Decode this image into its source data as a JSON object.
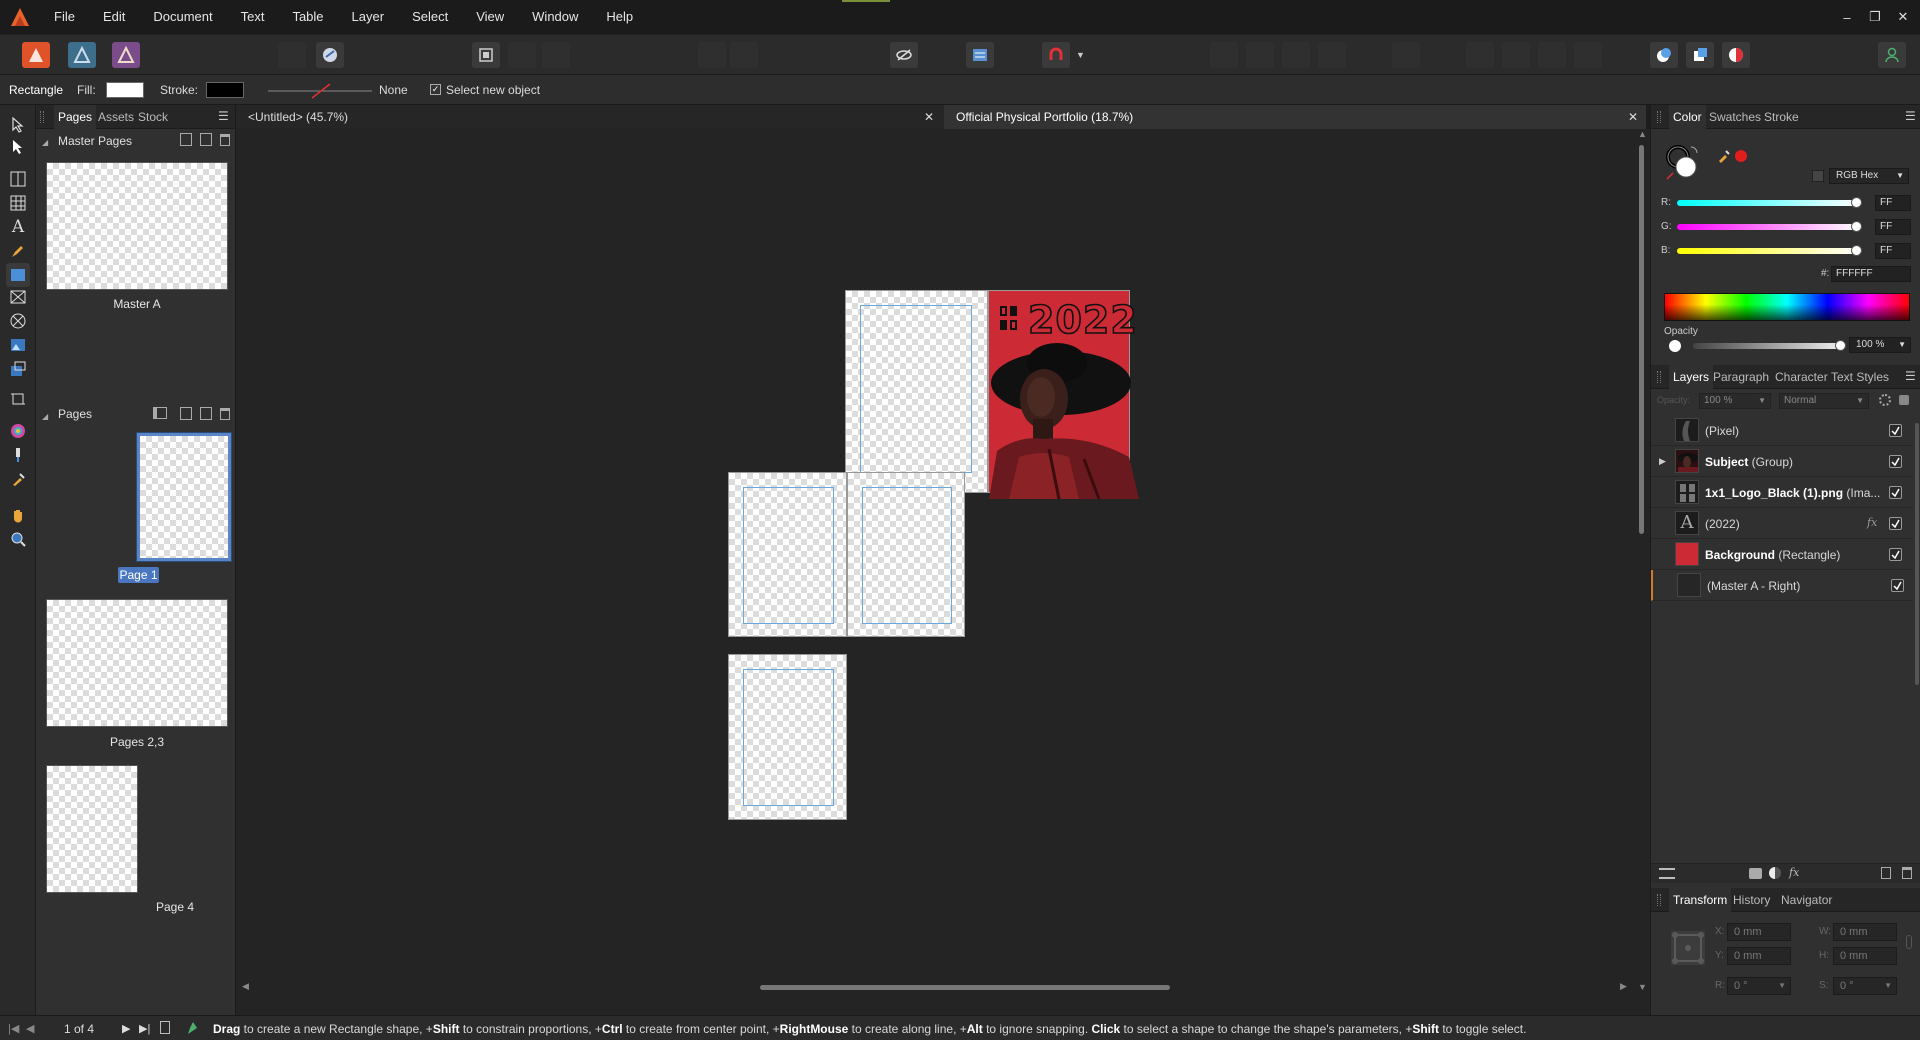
{
  "menu": [
    "File",
    "Edit",
    "Document",
    "Text",
    "Table",
    "Layer",
    "Select",
    "View",
    "Window",
    "Help"
  ],
  "context": {
    "tool_name": "Rectangle",
    "fill_label": "Fill:",
    "stroke_label": "Stroke:",
    "stroke_style": "None",
    "select_new_label": "Select new object",
    "fill_color": "#ffffff",
    "stroke_color": "#000000"
  },
  "left_panel": {
    "tabs": [
      "Pages",
      "Assets",
      "Stock"
    ],
    "master_pages_title": "Master Pages",
    "master_a_label": "Master A",
    "pages_title": "Pages",
    "page1_label": "Page 1",
    "pages23_label": "Pages 2,3",
    "page4_label": "Page 4"
  },
  "doc_tabs": {
    "untitled": "<Untitled> (45.7%)",
    "portfolio": "Official Physical Portfolio (18.7%)"
  },
  "canvas": {
    "cover_year": "2022",
    "cover_bg": "#cc2a35"
  },
  "color_panel": {
    "tabs": [
      "Color",
      "Swatches",
      "Stroke"
    ],
    "mode": "RGB Hex",
    "r_label": "R:",
    "g_label": "G:",
    "b_label": "B:",
    "r_value": "FF",
    "g_value": "FF",
    "b_value": "FF",
    "hex_label": "#:",
    "hex_value": "FFFFFF",
    "opacity_label": "Opacity",
    "opacity_value": "100 %"
  },
  "layers_panel": {
    "tabs": [
      "Layers",
      "Paragraph",
      "Character",
      "Text Styles"
    ],
    "opacity_label": "Opacity:",
    "opacity_value": "100 %",
    "blend_mode": "Normal",
    "layers": [
      {
        "bold": "",
        "rest": "(Pixel)"
      },
      {
        "bold": "Subject",
        "rest": " (Group)"
      },
      {
        "bold": "1x1_Logo_Black (1).png",
        "rest": " (Ima..."
      },
      {
        "bold": "",
        "rest": "(2022)"
      },
      {
        "bold": "Background",
        "rest": " (Rectangle)"
      },
      {
        "bold": "",
        "rest": "(Master A - Right)"
      }
    ]
  },
  "transform_panel": {
    "tabs": [
      "Transform",
      "History",
      "Navigator"
    ],
    "x_label": "X:",
    "y_label": "Y:",
    "w_label": "W:",
    "h_label": "H:",
    "r_label": "R:",
    "s_label": "S:",
    "x": "0 mm",
    "y": "0 mm",
    "w": "0 mm",
    "h": "0 mm",
    "r": "0 °",
    "s": "0 °"
  },
  "status": {
    "page_counter": "1 of 4",
    "hint_parts": [
      {
        "b": "Drag",
        "t": " to create a new Rectangle shape, +"
      },
      {
        "b": "Shift",
        "t": " to constrain proportions, +"
      },
      {
        "b": "Ctrl",
        "t": " to create from center point, +"
      },
      {
        "b": "RightMouse",
        "t": " to create along line, +"
      },
      {
        "b": "Alt",
        "t": " to ignore snapping. "
      },
      {
        "b": "Click",
        "t": " to select a shape to change the shape's parameters, +"
      },
      {
        "b": "Shift",
        "t": " to toggle select."
      }
    ]
  }
}
